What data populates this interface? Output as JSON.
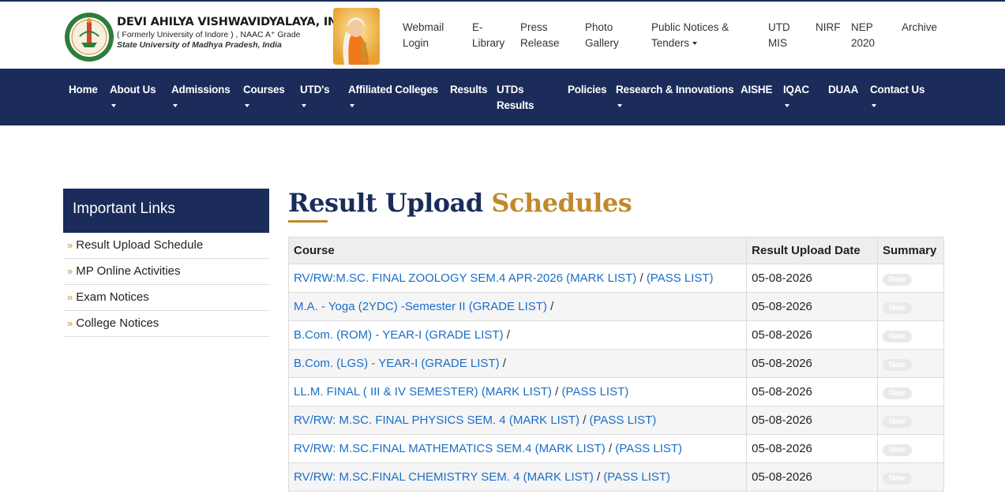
{
  "header": {
    "brand_name": "DEVI AHILYA VISHWAVIDYALAYA, INDORE",
    "brand_sub1": "( Formerly University of Indore ) , NAAC A⁺ Grade",
    "brand_sub2": "State University of Madhya Pradesh, India",
    "top_links": [
      {
        "line1": "Webmail",
        "line2": "Login"
      },
      {
        "line1": "E-",
        "line2": "Library"
      },
      {
        "line1": "Press",
        "line2": "Release"
      },
      {
        "line1": "Photo",
        "line2": "Gallery"
      },
      {
        "line1": "Public Notices &",
        "line2": "Tenders"
      },
      {
        "line1": "UTD",
        "line2": "MIS"
      },
      {
        "line1": "NIRF",
        "line2": ""
      },
      {
        "line1": "NEP",
        "line2": "2020"
      },
      {
        "line1": "Archive",
        "line2": ""
      }
    ]
  },
  "nav": {
    "items": [
      {
        "label": "Home"
      },
      {
        "label": "About Us"
      },
      {
        "label": "Admissions"
      },
      {
        "label": "Courses"
      },
      {
        "label": "UTD's"
      },
      {
        "label": "Affiliated Colleges"
      },
      {
        "label": "Results"
      },
      {
        "line1": "UTDs",
        "line2": "Results"
      },
      {
        "label": "Policies"
      },
      {
        "label": "Research & Innovations"
      },
      {
        "label": "AISHE"
      },
      {
        "label": "IQAC"
      },
      {
        "label": "DUAA"
      },
      {
        "label": "Contact Us"
      }
    ]
  },
  "sidebar": {
    "title": "Important Links",
    "bullet": "»",
    "items": [
      {
        "label": "Result Upload Schedule"
      },
      {
        "label": "MP Online Activities"
      },
      {
        "label": "Exam Notices"
      },
      {
        "label": "College Notices"
      }
    ]
  },
  "main": {
    "title_part1": "Result Upload",
    "title_part2": "Schedules",
    "columns": [
      "Course",
      "Result Upload Date",
      "Summary"
    ],
    "separator": "/",
    "badge": "New",
    "rows": [
      {
        "link1": "RV/RW:M.SC. FINAL ZOOLOGY SEM.4 APR-2026 (MARK LIST)",
        "link2": "(PASS LIST)",
        "date": "05-08-2026"
      },
      {
        "link1": "M.A. - Yoga (2YDC) -Semester II (GRADE LIST)",
        "link2": "",
        "date": "05-08-2026"
      },
      {
        "link1": "B.Com. (ROM) - YEAR-I (GRADE LIST)",
        "link2": "",
        "date": "05-08-2026"
      },
      {
        "link1": "B.Com. (LGS) - YEAR-I (GRADE LIST)",
        "link2": "",
        "date": "05-08-2026"
      },
      {
        "link1": "LL.M. FINAL ( III & IV SEMESTER) (MARK LIST)",
        "link2": "(PASS LIST)",
        "date": "05-08-2026"
      },
      {
        "link1": "RV/RW: M.SC. FINAL PHYSICS SEM. 4 (MARK LIST)",
        "link2": "(PASS LIST)",
        "date": "05-08-2026"
      },
      {
        "link1": "RV/RW: M.SC.FINAL MATHEMATICS SEM.4 (MARK LIST)",
        "link2": "(PASS LIST)",
        "date": "05-08-2026"
      },
      {
        "link1": "RV/RW: M.SC.FINAL CHEMISTRY SEM. 4 (MARK LIST)",
        "link2": "(PASS LIST)",
        "date": "05-08-2026"
      }
    ]
  }
}
